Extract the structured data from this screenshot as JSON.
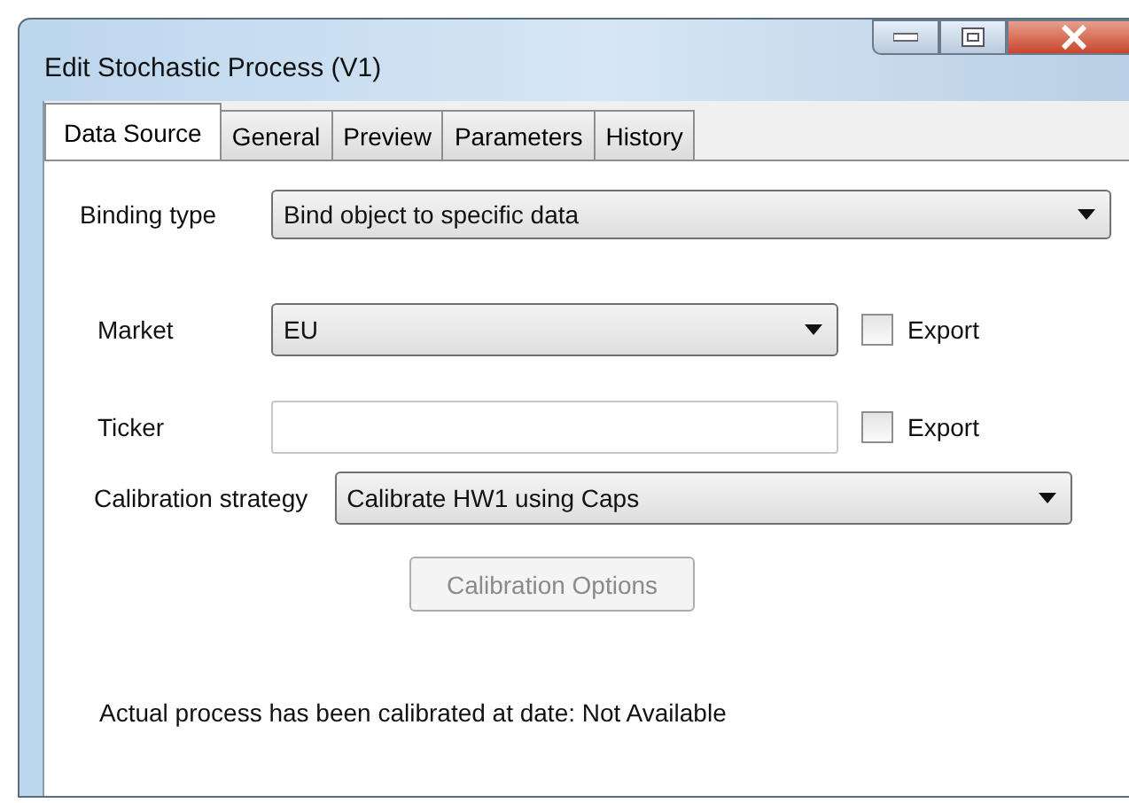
{
  "window": {
    "title": "Edit Stochastic Process (V1)"
  },
  "tabs": [
    {
      "label": "Data Source",
      "selected": true
    },
    {
      "label": "General",
      "selected": false
    },
    {
      "label": "Preview",
      "selected": false
    },
    {
      "label": "Parameters",
      "selected": false
    },
    {
      "label": "History",
      "selected": false
    }
  ],
  "binding": {
    "label": "Binding type",
    "value": "Bind object to specific data"
  },
  "fields": [
    {
      "kind": "combo",
      "label": "Market",
      "value": "EU",
      "export": {
        "label": "Export",
        "checked": false
      }
    },
    {
      "kind": "text",
      "label": "Ticker",
      "export": {
        "label": "Export",
        "checked": false
      }
    }
  ],
  "calibration": {
    "label": "Calibration strategy",
    "value": "Calibrate HW1 using Caps",
    "button": {
      "label": "Calibration Options",
      "disabled": true
    }
  },
  "status": "Actual process has been calibrated at date: Not Available"
}
